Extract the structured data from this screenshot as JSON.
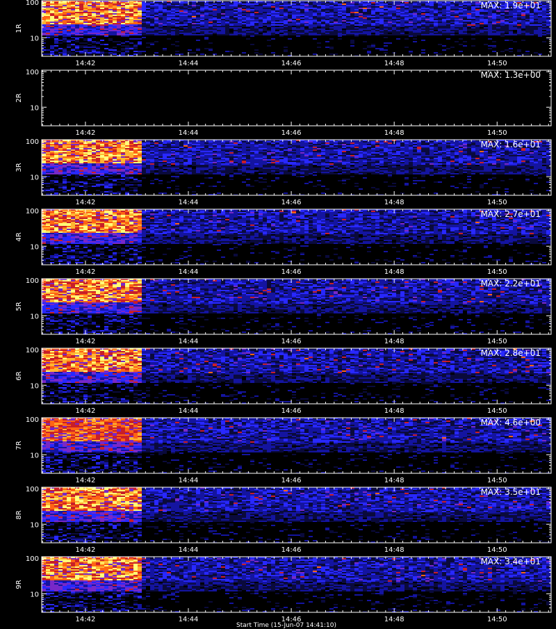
{
  "chart_data": [
    {
      "type": "heatmap",
      "ylabel": "1R",
      "max_label": "MAX: 1.9e+01"
    },
    {
      "type": "heatmap",
      "ylabel": "2R",
      "max_label": "MAX: 1.3e+00"
    },
    {
      "type": "heatmap",
      "ylabel": "3R",
      "max_label": "MAX: 1.6e+01"
    },
    {
      "type": "heatmap",
      "ylabel": "4R",
      "max_label": "MAX: 2.7e+01"
    },
    {
      "type": "heatmap",
      "ylabel": "5R",
      "max_label": "MAX: 2.2e+01"
    },
    {
      "type": "heatmap",
      "ylabel": "6R",
      "max_label": "MAX: 2.8e+01"
    },
    {
      "type": "heatmap",
      "ylabel": "7R",
      "max_label": "MAX: 4.6e+00"
    },
    {
      "type": "heatmap",
      "ylabel": "8R",
      "max_label": "MAX: 3.5e+01"
    },
    {
      "type": "heatmap",
      "ylabel": "9R",
      "max_label": "MAX: 3.4e+01"
    }
  ],
  "shared_axes": {
    "x_ticks": [
      "14:42",
      "14:44",
      "14:46",
      "14:48",
      "14:50"
    ],
    "x_tick_minutes": [
      42,
      44,
      46,
      48,
      50
    ],
    "x_range_minutes": [
      41.15,
      51.05
    ],
    "burst_end_minutes": 43.05,
    "y_ticks": [
      "100",
      "10"
    ],
    "y_tick_values": [
      100,
      10
    ],
    "y_range": [
      3,
      110
    ],
    "y_scale": "log"
  },
  "colors": {
    "background": "#000000",
    "axis": "#ffffff",
    "colormap": [
      "#000000",
      "#0a0a3c",
      "#1414a0",
      "#2828ff",
      "#7828c8",
      "#c81e28",
      "#ff6414",
      "#ffb432",
      "#ffff78"
    ]
  },
  "footer": {
    "text": "Start Time (15-Jun-07 14:41:10)"
  }
}
